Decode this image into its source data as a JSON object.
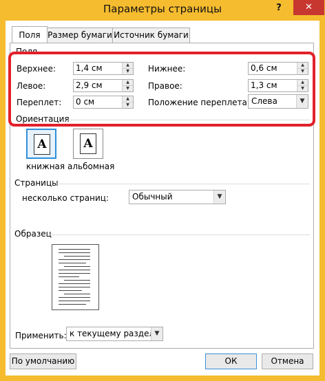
{
  "window": {
    "title": "Параметры страницы",
    "help_label": "?",
    "close_label": "✕"
  },
  "tabs": [
    {
      "label": "Поля",
      "active": true
    },
    {
      "label": "Размер бумаги",
      "active": false
    },
    {
      "label": "Источник бумаги",
      "active": false
    }
  ],
  "margins": {
    "section_label": "Поля",
    "top_label": "Верхнее:",
    "top_value": "1,4 см",
    "left_label": "Левое:",
    "left_value": "2,9 см",
    "gutter_label": "Переплет:",
    "gutter_value": "0 см",
    "bottom_label": "Нижнее:",
    "bottom_value": "0,6 см",
    "right_label": "Правое:",
    "right_value": "1,3 см",
    "gutter_pos_label": "Положение переплета:",
    "gutter_pos_value": "Слева"
  },
  "orientation": {
    "section_label": "Ориентация",
    "portrait_label": "книжная",
    "landscape_label": "альбомная",
    "icon_letter": "A",
    "selected": "portrait"
  },
  "pages": {
    "section_label": "Страницы",
    "multiple_label": "несколько страниц:",
    "multiple_value": "Обычный"
  },
  "preview": {
    "section_label": "Образец"
  },
  "apply": {
    "label": "Применить:",
    "value": "к текущему разделу"
  },
  "buttons": {
    "default_label": "По умолчанию",
    "ok_label": "ОК",
    "cancel_label": "Отмена"
  },
  "colors": {
    "frame": "#f6bc2f",
    "highlight": "#e2202a",
    "close": "#c7372f",
    "selection": "#2f8fd8"
  }
}
